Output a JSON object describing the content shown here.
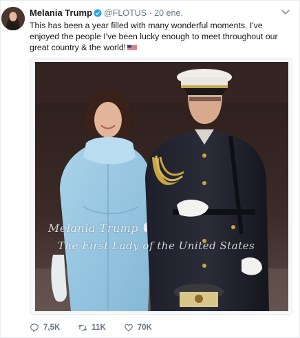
{
  "tweet": {
    "author_name": "Melania Trump",
    "handle": "@FLOTUS",
    "separator": "·",
    "time": "20 ene.",
    "text": "This has been a year filled with many wonderful moments. I've enjoyed the people I've been lucky enough to meet throughout our great country & the world!",
    "flag_icon": "us-flag-icon",
    "verified_icon": "verified-badge-icon",
    "caret_icon": "chevron-down-icon"
  },
  "media": {
    "watermark_line1": "Melania Trump",
    "watermark_line2": "The First Lady of the United States"
  },
  "actions": {
    "replies": "7,5K",
    "retweets": "11K",
    "likes": "70K"
  },
  "colors": {
    "text": "#14171a",
    "secondary": "#657786",
    "verified": "#1da1f2",
    "border": "#e6ecf0"
  }
}
